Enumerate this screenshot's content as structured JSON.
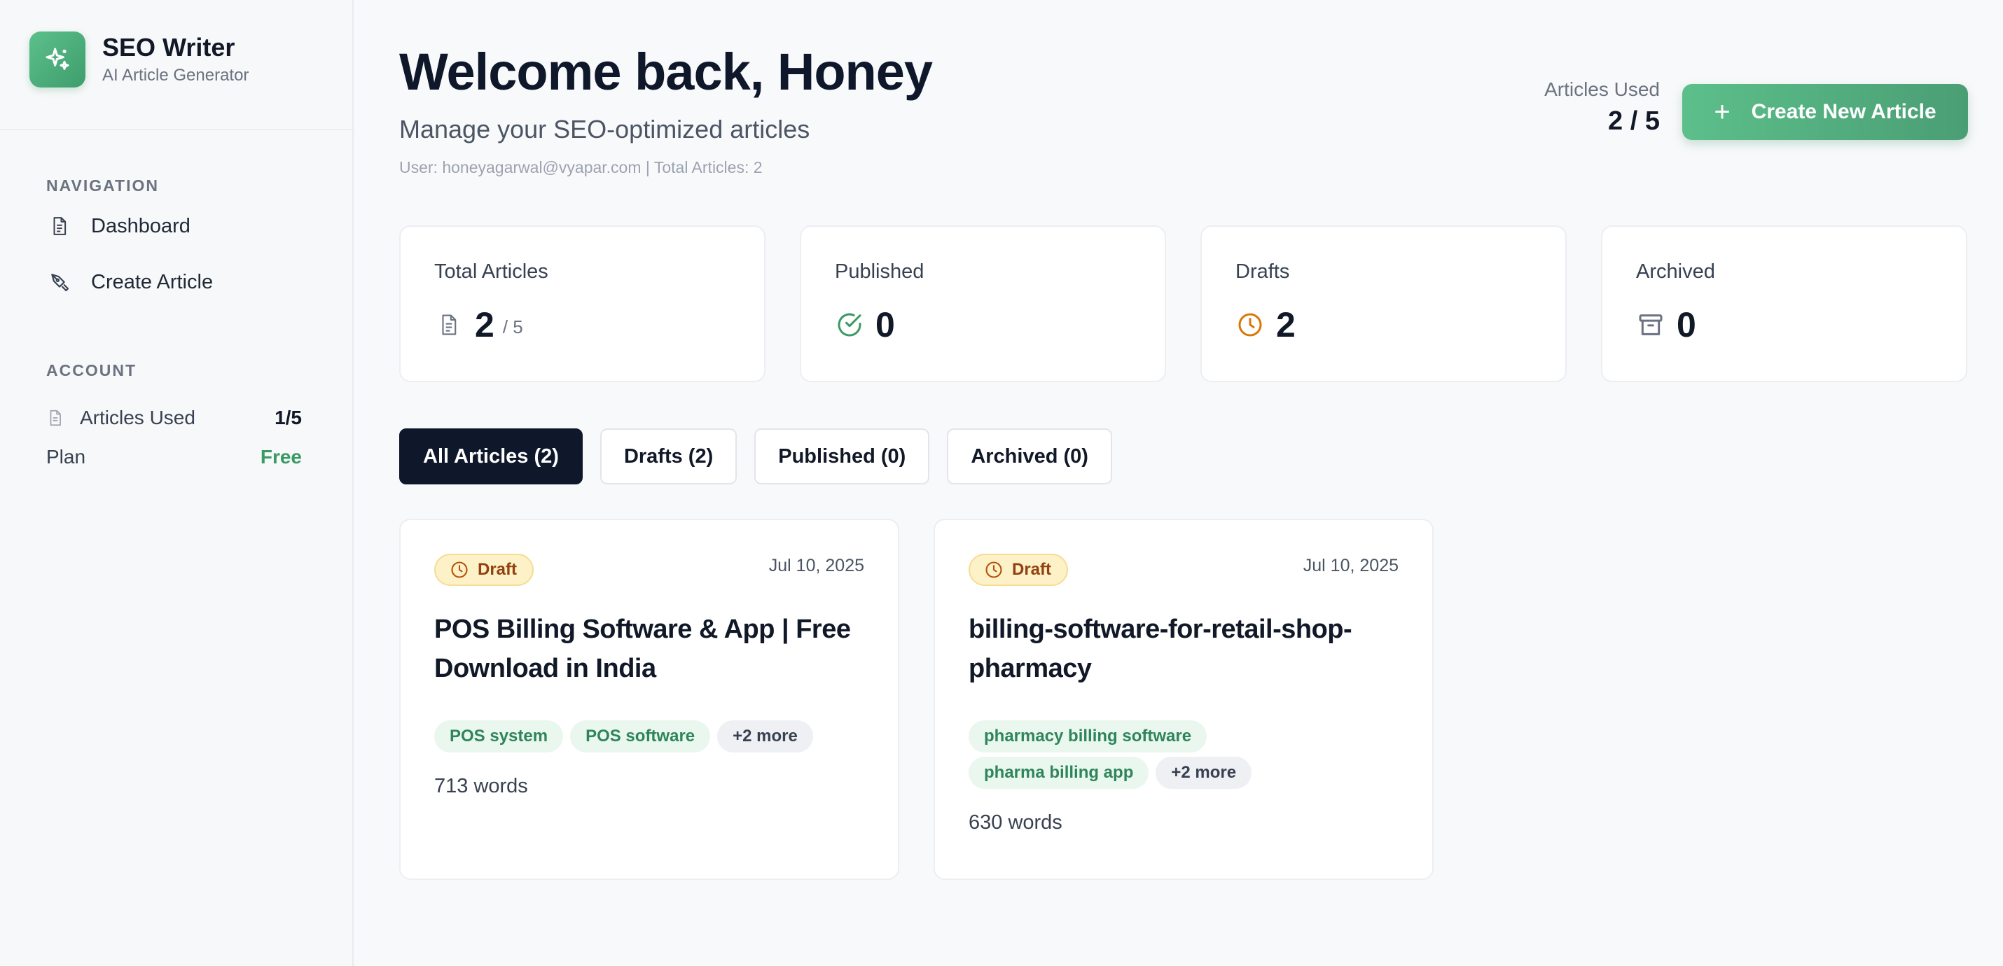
{
  "brand": {
    "name": "SEO Writer",
    "subtitle": "AI Article Generator"
  },
  "sidebar": {
    "nav_title": "NAVIGATION",
    "items": [
      {
        "label": "Dashboard",
        "icon": "document-icon"
      },
      {
        "label": "Create Article",
        "icon": "pen-icon"
      }
    ],
    "account_title": "ACCOUNT",
    "account": [
      {
        "label": "Articles Used",
        "value": "1/5",
        "icon": "document-icon"
      },
      {
        "label": "Plan",
        "value": "Free"
      }
    ]
  },
  "header": {
    "title": "Welcome back, Honey",
    "subtitle": "Manage your SEO-optimized articles",
    "userline": "User: honeyagarwal@vyapar.com | Total Articles: 2",
    "usage_label": "Articles Used",
    "usage_value": "2 / 5",
    "create_label": "Create New Article"
  },
  "stats": [
    {
      "label": "Total Articles",
      "value": "2",
      "sub": "/ 5",
      "icon": "document-icon",
      "color": "#6b7280"
    },
    {
      "label": "Published",
      "value": "0",
      "icon": "check-circle-icon",
      "color": "#3a9a63"
    },
    {
      "label": "Drafts",
      "value": "2",
      "icon": "clock-icon",
      "color": "#d97706"
    },
    {
      "label": "Archived",
      "value": "0",
      "icon": "archive-icon",
      "color": "#6b7280"
    }
  ],
  "tabs": [
    {
      "label": "All Articles (2)",
      "active": true
    },
    {
      "label": "Drafts (2)"
    },
    {
      "label": "Published (0)"
    },
    {
      "label": "Archived (0)"
    }
  ],
  "articles": [
    {
      "status": "Draft",
      "date": "Jul 10, 2025",
      "title": "POS Billing Software & App | Free Download in India",
      "tags": [
        "POS system",
        "POS software"
      ],
      "more": "+2 more",
      "words": "713 words"
    },
    {
      "status": "Draft",
      "date": "Jul 10, 2025",
      "title": "billing-software-for-retail-shop-pharmacy",
      "tags": [
        "pharmacy billing software",
        "pharma billing app"
      ],
      "more": "+2 more",
      "words": "630 words"
    }
  ],
  "colors": {
    "accent": "#4cad7a",
    "dark": "#0f172a",
    "draft_bg": "#fdf1c8"
  }
}
